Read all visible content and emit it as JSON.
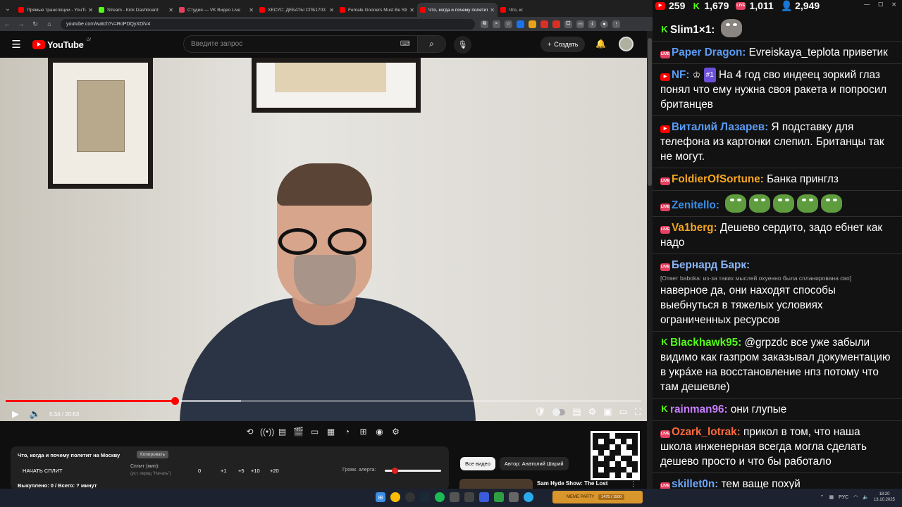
{
  "browser": {
    "tabs": [
      {
        "title": "Прямые трансляции - YouTube",
        "color": "#ff0000",
        "active": false
      },
      {
        "title": "Stream - Kick Dashboard",
        "color": "#53fc18",
        "active": false
      },
      {
        "title": "Студия — VK Видео Live",
        "color": "#e4405f",
        "active": false
      },
      {
        "title": "ХЕСУС: ДЕБАТЫ СПБ1703 И",
        "color": "#ff0000",
        "active": false
      },
      {
        "title": "Female Gooners Must Be Stre",
        "color": "#ff0000",
        "active": false
      },
      {
        "title": "Что, когда и почему полетит",
        "color": "#ff0000",
        "active": true
      },
      {
        "title": "Что, когда и почему п",
        "color": "#ff0000",
        "active": false
      }
    ],
    "url": "youtube.com/watch?v=RoPDQyXDiV4"
  },
  "youtube": {
    "logo_text": "YouTube",
    "logo_region": "LV",
    "search_placeholder": "Введите запрос",
    "create_label": "Создать",
    "video": {
      "time": "5:34 / 20:53",
      "progress": 0.266,
      "title": "Что, когда и почему полетит на Москву"
    },
    "panel": {
      "copy_label": "Копировать",
      "split_button": "НАЧАТЬ СПЛИТ",
      "split_label": "Сплит (мин):",
      "split_hint": "(уст. перед \"Начать\")",
      "steps": [
        "0",
        "+1",
        "+5",
        "+10",
        "+20"
      ],
      "alert_volume_label": "Громк. алерта:",
      "stats": "Выкуплено: 0 / Всего: ? минут"
    },
    "chips": [
      "Все видео",
      "Автор: Анатолий Шарий"
    ],
    "recommendation_title": "Sam Hyde Show: The Lost"
  },
  "chat": {
    "stats": [
      {
        "platform": "youtube",
        "count": "259"
      },
      {
        "platform": "kick",
        "count": "1,679"
      },
      {
        "platform": "vk",
        "count": "1,011"
      },
      {
        "platform": "viewers",
        "count": "2,949"
      }
    ],
    "messages": [
      {
        "platform": "kick",
        "nick": "Slim1×1:",
        "color": "#ffffff",
        "text": "",
        "emote": "cat-emote"
      },
      {
        "platform": "vk",
        "nick": "Paper Dragon:",
        "color": "#5b9cf5",
        "text": "Evreiskaya_teplota приветик"
      },
      {
        "platform": "youtube",
        "nick": "NF:",
        "color": "#5b9cf5",
        "badges": "#1",
        "text": "На 4 год сво индеец зоркий глаз понял что ему нужна своя ракета и попросил британцев"
      },
      {
        "platform": "youtube",
        "nick": "Виталий Лазарев:",
        "color": "#5b9cf5",
        "text": "Я подставку для телефона из картонки слепил. Британцы так не могут."
      },
      {
        "platform": "vk",
        "nick": "FoldierOfSortune:",
        "color": "#f5a623",
        "text": "Банка принглз"
      },
      {
        "platform": "vk",
        "nick": "Zenitello:",
        "color": "#3a8ee6",
        "text": "",
        "emote_count": 5
      },
      {
        "platform": "vk",
        "nick": "Va1berg:",
        "color": "#f5a623",
        "text": "Дешево сердито, задо ебнет как надо"
      },
      {
        "platform": "vk",
        "nick": "Бернард Барк:",
        "color": "#8ab4f8",
        "reply": "[Ответ baboka: из-за таких мыслей охуенно была спланирована сво]",
        "text": "наверное да, они находят способы выебнуться в тяжелых условиях ограниченных ресурсов"
      },
      {
        "platform": "kick",
        "nick": "Blackhawk95:",
        "color": "#53fc18",
        "text": "@grpzdc все уже забыли видимо как газпром заказывал документацию в укрáхе на восстановление нпз потому что там дешевле)"
      },
      {
        "platform": "kick",
        "nick": "rainman96:",
        "color": "#c77dff",
        "text": "они глупые"
      },
      {
        "platform": "vk",
        "nick": "Ozark_lotrak:",
        "color": "#ff6a3d",
        "text": "прикол в том, что наша школа инженерная всегда могла сделать дешево просто и что бы работало"
      },
      {
        "platform": "vk",
        "nick": "skillet0n:",
        "color": "#6aa8ff",
        "text": "тем ваще похуй"
      }
    ]
  },
  "taskbar": {
    "tray_label": "MEME PARTY",
    "tray_progress": "1475 / 1500",
    "lang": "РУС",
    "time": "18:20",
    "date": "13.10.2025"
  }
}
